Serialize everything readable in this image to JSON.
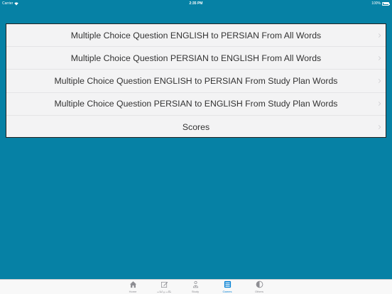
{
  "status_bar": {
    "carrier": "Carrier",
    "time": "2:35 PM",
    "battery": "100%"
  },
  "menu": {
    "items": [
      {
        "label": "Multiple Choice Question ENGLISH to PERSIAN From All Words"
      },
      {
        "label": "Multiple Choice Question PERSIAN to ENGLISH From All Words"
      },
      {
        "label": "Multiple Choice Question ENGLISH to PERSIAN From Study Plan Words"
      },
      {
        "label": "Multiple Choice Question PERSIAN to ENGLISH From Study Plan Words"
      },
      {
        "label": "Scores"
      }
    ]
  },
  "tab_bar": {
    "active": "Games",
    "tabs": [
      {
        "label": "Home",
        "icon": "home-icon"
      },
      {
        "label": "نکات و لغات",
        "icon": "edit-icon"
      },
      {
        "label": "Study",
        "icon": "study-icon"
      },
      {
        "label": "Games",
        "icon": "games-icon"
      },
      {
        "label": "Others",
        "icon": "others-icon"
      }
    ]
  },
  "colors": {
    "background": "#0681a5",
    "active_tab": "#0a84d6",
    "inactive_tab": "#8e8e93"
  }
}
